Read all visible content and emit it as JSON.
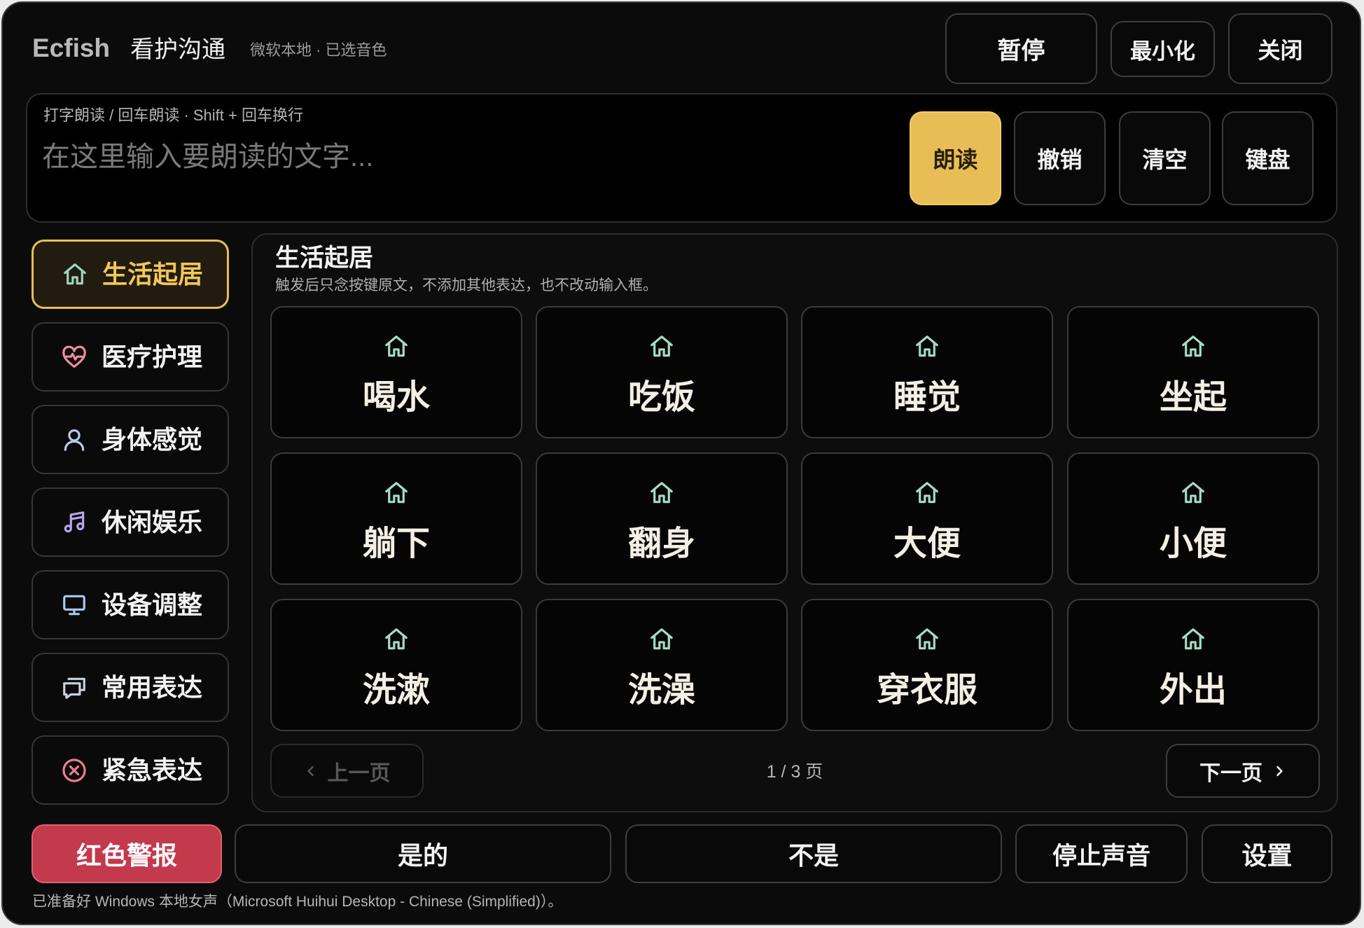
{
  "header": {
    "brand": "Ecfish",
    "title": "看护沟通",
    "voice_status": "微软本地 · 已选音色",
    "buttons": {
      "pause": "暂停",
      "minimize": "最小化",
      "close": "关闭"
    }
  },
  "input": {
    "hint": "打字朗读 / 回车朗读 · Shift + 回车换行",
    "placeholder": "在这里输入要朗读的文字...",
    "buttons": {
      "speak": "朗读",
      "undo": "撤销",
      "clear": "清空",
      "keyboard": "键盘"
    }
  },
  "sidebar": {
    "items": [
      {
        "label": "生活起居",
        "icon": "home-icon",
        "icon_color": "#9fd6c1",
        "active": true
      },
      {
        "label": "医疗护理",
        "icon": "heart-pulse-icon",
        "icon_color": "#ee8fa0",
        "active": false
      },
      {
        "label": "身体感觉",
        "icon": "person-icon",
        "icon_color": "#b9c9ea",
        "active": false
      },
      {
        "label": "休闲娱乐",
        "icon": "music-icon",
        "icon_color": "#b7a6ea",
        "active": false
      },
      {
        "label": "设备调整",
        "icon": "monitor-icon",
        "icon_color": "#a8c8ee",
        "active": false
      },
      {
        "label": "常用表达",
        "icon": "chat-icon",
        "icon_color": "#c9d1dd",
        "active": false
      },
      {
        "label": "紧急表达",
        "icon": "x-circle-icon",
        "icon_color": "#ec7f8f",
        "active": false
      }
    ]
  },
  "category": {
    "title": "生活起居",
    "description": "触发后只念按键原文，不添加其他表达，也不改动输入框。",
    "phrase_icon": "home-icon",
    "phrases": [
      "喝水",
      "吃饭",
      "睡觉",
      "坐起",
      "躺下",
      "翻身",
      "大便",
      "小便",
      "洗漱",
      "洗澡",
      "穿衣服",
      "外出"
    ]
  },
  "pagination": {
    "prev": "上一页",
    "next": "下一页",
    "page_label": "1 / 3 页"
  },
  "bottom_bar": {
    "alert": "红色警报",
    "yes": "是的",
    "no": "不是",
    "stop": "停止声音",
    "settings": "设置"
  },
  "status": "已准备好 Windows 本地女声（Microsoft Huihui Desktop - Chinese (Simplified)）。",
  "colors": {
    "accent": "#e8bd55",
    "alert": "#c23a4b",
    "phrase_icon": "#a6dcc6",
    "background": "#0b0b0b"
  }
}
